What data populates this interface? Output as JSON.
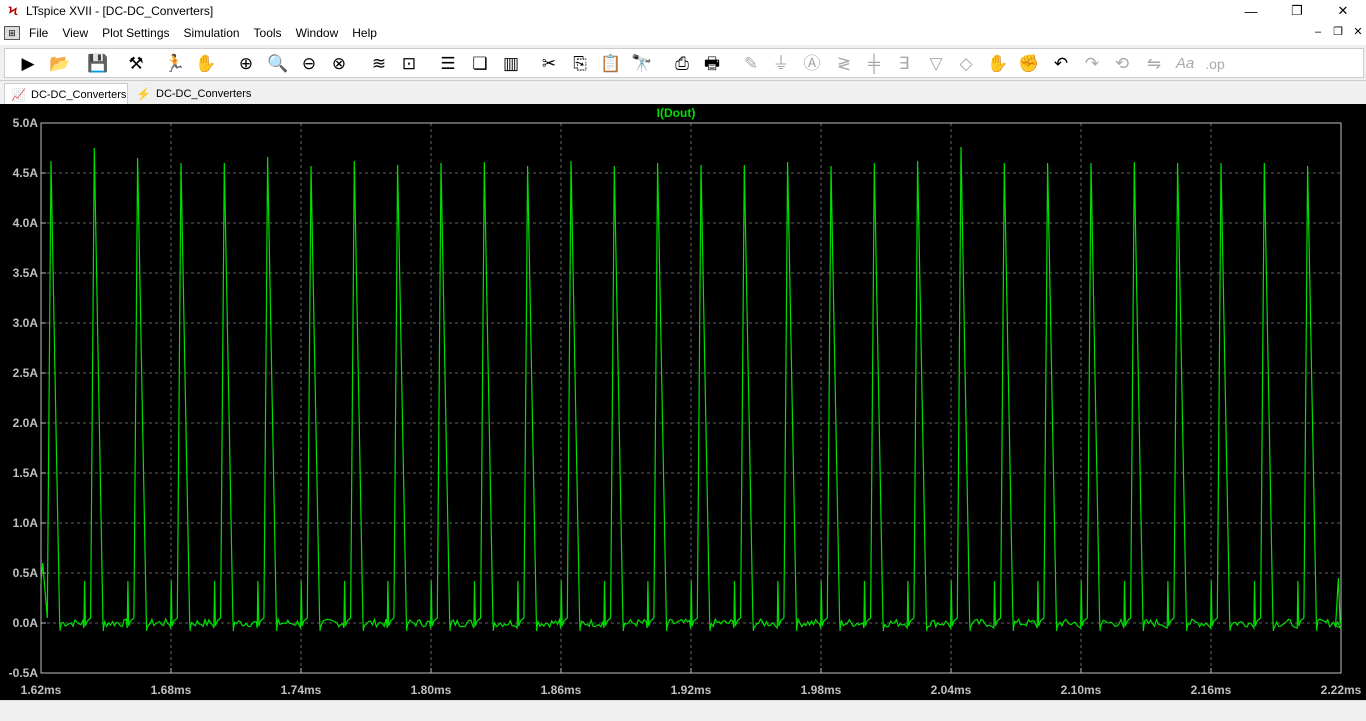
{
  "window": {
    "title": "LTspice XVII - [DC-DC_Converters]",
    "app_icon": "ltspice-logo-icon",
    "controls": [
      "minimize",
      "maximize",
      "close"
    ]
  },
  "menu": {
    "items": [
      "File",
      "View",
      "Plot Settings",
      "Simulation",
      "Tools",
      "Window",
      "Help"
    ]
  },
  "toolbar": {
    "buttons": [
      {
        "name": "run-icon",
        "enabled": true
      },
      {
        "name": "open-icon",
        "enabled": true
      },
      {
        "name": "save-icon",
        "enabled": true
      },
      {
        "name": "control-panel-icon",
        "enabled": true
      },
      {
        "name": "run-simulation-icon",
        "enabled": true
      },
      {
        "name": "halt-icon",
        "enabled": true
      },
      {
        "name": "zoom-in-icon",
        "enabled": true
      },
      {
        "name": "zoom-area-icon",
        "enabled": true
      },
      {
        "name": "zoom-out-icon",
        "enabled": true
      },
      {
        "name": "zoom-cancel-icon",
        "enabled": true
      },
      {
        "name": "autorange-icon",
        "enabled": true
      },
      {
        "name": "pick-visible-icon",
        "enabled": true
      },
      {
        "name": "tile-horizontal-icon",
        "enabled": true
      },
      {
        "name": "cascade-icon",
        "enabled": true
      },
      {
        "name": "tile-vertical-icon",
        "enabled": true
      },
      {
        "name": "cut-icon",
        "enabled": true
      },
      {
        "name": "copy-icon",
        "enabled": true
      },
      {
        "name": "paste-icon",
        "enabled": true
      },
      {
        "name": "find-icon",
        "enabled": true
      },
      {
        "name": "print-icon",
        "enabled": true
      },
      {
        "name": "print-setup-icon",
        "enabled": true
      },
      {
        "name": "wire-icon",
        "enabled": false
      },
      {
        "name": "ground-icon",
        "enabled": false
      },
      {
        "name": "label-icon",
        "enabled": false
      },
      {
        "name": "resistor-icon",
        "enabled": false
      },
      {
        "name": "capacitor-icon",
        "enabled": false
      },
      {
        "name": "inductor-icon",
        "enabled": false
      },
      {
        "name": "diode-icon",
        "enabled": false
      },
      {
        "name": "component-icon",
        "enabled": false
      },
      {
        "name": "move-icon",
        "enabled": false
      },
      {
        "name": "drag-icon",
        "enabled": false
      },
      {
        "name": "undo-icon",
        "enabled": true
      },
      {
        "name": "redo-icon",
        "enabled": false
      },
      {
        "name": "rotate-icon",
        "enabled": false
      },
      {
        "name": "mirror-icon",
        "enabled": false
      },
      {
        "name": "text-icon",
        "enabled": false
      },
      {
        "name": "spice-directive-icon",
        "enabled": false
      }
    ],
    "directive_text": ".op",
    "text_glyph": "Aa"
  },
  "tabs": [
    {
      "label": "DC-DC_Converters",
      "icon": "waveform-icon",
      "active": true
    },
    {
      "label": "DC-DC_Converters",
      "icon": "schematic-icon",
      "active": false
    }
  ],
  "colors": {
    "trace": "#00e000",
    "background": "#000000",
    "grid": "#808080",
    "axis_text": "#c0c0c0"
  },
  "chart_data": {
    "type": "line",
    "title": "I(Dout)",
    "xlabel": "",
    "ylabel": "",
    "xlim": [
      1.62,
      2.22
    ],
    "ylim": [
      -0.5,
      5.0
    ],
    "x_unit": "ms",
    "y_unit": "A",
    "x_ticks": [
      "1.62ms",
      "1.68ms",
      "1.74ms",
      "1.80ms",
      "1.86ms",
      "1.92ms",
      "1.98ms",
      "2.04ms",
      "2.10ms",
      "2.16ms",
      "2.22ms"
    ],
    "y_ticks": [
      "5.0A",
      "4.5A",
      "4.0A",
      "3.5A",
      "3.0A",
      "2.5A",
      "2.0A",
      "1.5A",
      "1.0A",
      "0.5A",
      "0.0A",
      "-0.5A"
    ],
    "grid": true,
    "series": [
      {
        "name": "I(Dout)",
        "period_ms": 0.02,
        "first_peak_ms": 1.6246,
        "baseline_A": 0.0,
        "ringing_spike_A": 0.42,
        "peak_values_A": [
          4.62,
          4.75,
          4.65,
          4.6,
          4.6,
          4.66,
          4.57,
          4.62,
          4.58,
          4.6,
          4.61,
          4.57,
          4.62,
          4.57,
          4.6,
          4.58,
          4.58,
          4.61,
          4.57,
          4.6,
          4.62,
          4.76,
          4.6,
          4.6,
          4.6,
          4.61,
          4.6,
          4.6,
          4.6,
          4.57,
          4.58,
          4.56,
          4.57,
          4.56,
          4.56,
          4.57,
          4.56,
          4.66,
          4.57,
          4.61,
          4.57,
          4.6,
          4.56,
          4.57,
          4.56,
          4.66,
          4.58,
          4.57,
          4.56,
          4.6,
          4.58,
          4.56,
          4.57,
          4.57,
          4.56,
          4.66,
          4.56,
          4.61,
          4.58,
          4.51
        ]
      }
    ]
  }
}
